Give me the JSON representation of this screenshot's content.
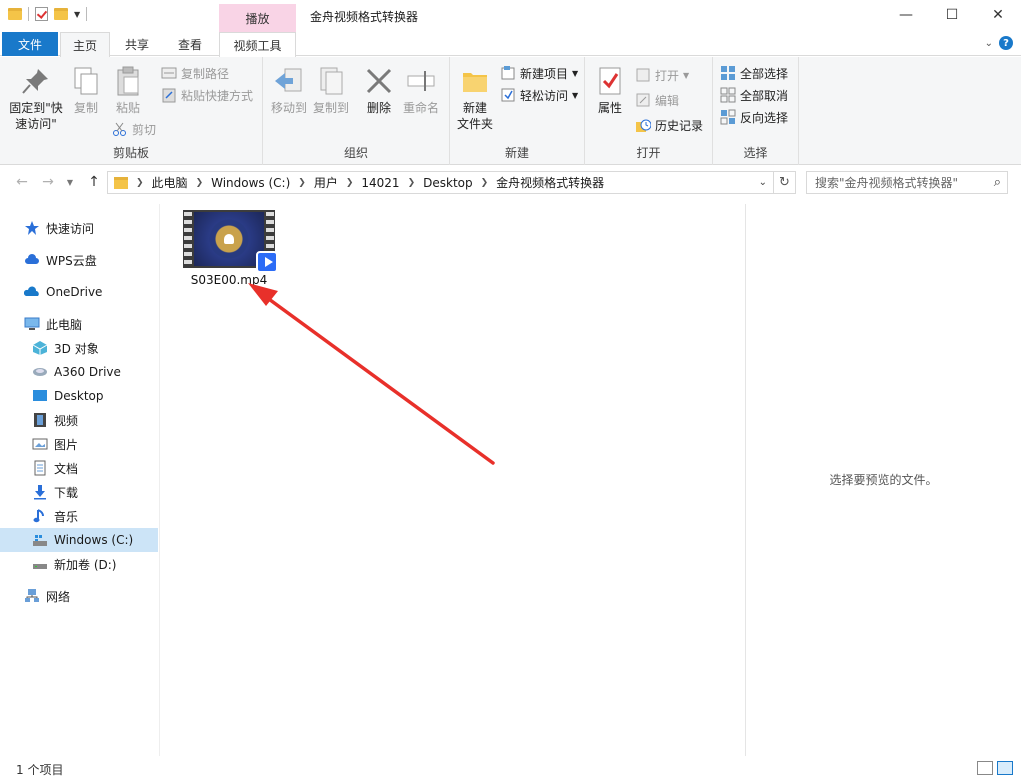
{
  "window": {
    "title": "金舟视频格式转换器",
    "tools_header": "播放",
    "controls": {
      "minimize": "—",
      "maximize": "☐",
      "close": "✕"
    }
  },
  "tabs": {
    "file": "文件",
    "home": "主页",
    "share": "共享",
    "view": "查看",
    "video_tools": "视频工具"
  },
  "ribbon": {
    "clipboard": {
      "label": "剪贴板",
      "pin": "固定到\"快\n速访问\"",
      "copy": "复制",
      "paste": "粘贴",
      "copy_path": "复制路径",
      "paste_shortcut": "粘贴快捷方式",
      "cut": "剪切"
    },
    "organize": {
      "label": "组织",
      "move_to": "移动到",
      "copy_to": "复制到",
      "delete": "删除",
      "rename": "重命名"
    },
    "new": {
      "label": "新建",
      "new_folder": "新建\n文件夹",
      "new_item": "新建项目",
      "easy_access": "轻松访问"
    },
    "open": {
      "label": "打开",
      "properties": "属性",
      "open": "打开",
      "edit": "编辑",
      "history": "历史记录"
    },
    "select": {
      "label": "选择",
      "select_all": "全部选择",
      "select_none": "全部取消",
      "invert": "反向选择"
    }
  },
  "address": {
    "crumbs": [
      "此电脑",
      "Windows (C:)",
      "用户",
      "14021",
      "Desktop",
      "金舟视频格式转换器"
    ],
    "search_placeholder": "搜索\"金舟视频格式转换器\""
  },
  "nav": {
    "quick_access": "快速访问",
    "wps": "WPS云盘",
    "onedrive": "OneDrive",
    "this_pc": "此电脑",
    "objects3d": "3D 对象",
    "a360": "A360 Drive",
    "desktop": "Desktop",
    "videos": "视频",
    "pictures": "图片",
    "documents": "文档",
    "downloads": "下载",
    "music": "音乐",
    "drive_c": "Windows (C:)",
    "drive_d": "新加卷 (D:)",
    "network": "网络"
  },
  "files": [
    {
      "name": "S03E00.mp4"
    }
  ],
  "preview": {
    "empty_text": "选择要预览的文件。"
  },
  "status": {
    "count": "1 个项目"
  },
  "colors": {
    "accent": "#1979ca",
    "tools_tab": "#f9d4e6",
    "selected": "#cce4f7",
    "annotation_arrow": "#e8302a"
  }
}
